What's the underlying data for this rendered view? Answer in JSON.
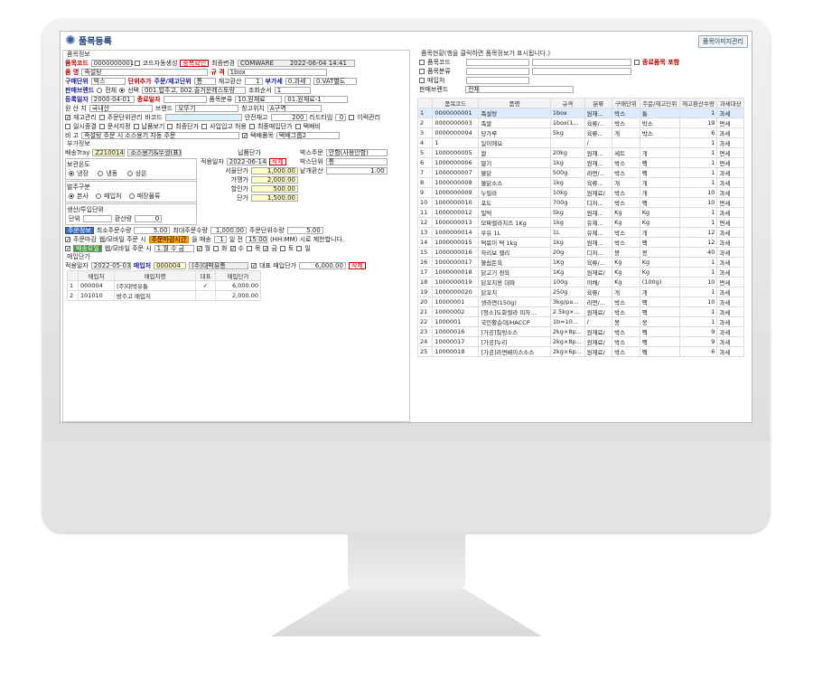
{
  "window": {
    "title": "품목등록",
    "image_button": "품목이미지관리"
  },
  "left": {
    "section_info": "품목정보",
    "code_label": "품목코드",
    "code_value": "0000000001",
    "auto_code": "코드자동생성",
    "dup_check": "중복확인",
    "last_changed_label": "최종변경",
    "last_changed_user": "COMWARE",
    "last_changed_time": "2022-06-04 14:41",
    "name_label": "품 명",
    "name_value": "족설탕",
    "spec_label": "규 격",
    "spec_value": "1box",
    "unit_label": "구매단위",
    "unit_value": "박스",
    "unit_add": "단위추가",
    "order_unit_label": "주문/재고단위",
    "order_unit_value": "통",
    "conv_label": "재고환산",
    "conv_value": "1",
    "tax_label": "부가세",
    "tax_value": "0.과세",
    "vat_value": "0.VAT별도",
    "brand_label": "판매브랜드",
    "brand_all": "전체",
    "brand_select": "선택",
    "brand_value": "001.밥주고, 002.즐거운레스토랑",
    "lookup_label": "조회순서",
    "lookup_value": "1",
    "reg_date_label": "등록일자",
    "reg_date_value": "2000-04-01",
    "end_date_label": "종료일자",
    "category_label": "품목분류",
    "category_value": "10.원재료",
    "category2_value": "01.원재료-1",
    "origin_label": "원 산 지",
    "origin_value": "국내산",
    "brandname_label": "브랜드",
    "brandname_value": "오뚜기",
    "warehouse_label": "창고위치",
    "warehouse_value": "A구역",
    "stock_mgmt": "재고관리",
    "order_unit_mgmt": "주문단위관리",
    "barcode_label": "바코드",
    "safety_label": "안전재고",
    "safety_value": "200",
    "leadtime_label": "리드타임",
    "leadtime_value": "0",
    "history_label": "이력관리",
    "daily_close": "일시종결",
    "no_print": "문서지정",
    "delivery": "납품보기",
    "final_price": "최종단가",
    "prepurchase": "사입입고 허용",
    "final_purchase": "최종매입단가",
    "tag": "택배비",
    "note_label": "비 고",
    "note_value": "즉설탕 주문 시 소스용기 자동 주문",
    "parcel_label": "택배품목",
    "parcel_value": "택배그룹2",
    "section_extra": "부가정보",
    "tray_label": "배송Tray",
    "tray_code": "Z210014",
    "tray_name": "소스용기&뚜껑(표)",
    "supply_section": "납품단가",
    "order_section": "박스주문",
    "order_value": "안함(사용안함)",
    "storage_section": "보관온도",
    "storage_opts": [
      "냉장",
      "냉동",
      "상온"
    ],
    "apply_date_label": "적용일자",
    "apply_date_value": "2022-06-14",
    "delete": "삭제",
    "box_unit_label": "박스단위",
    "box_unit_value": "통",
    "purchase_price_label": "서울단가",
    "purchase_price_value": "1,000.00",
    "piece_conv_label": "낱개환산",
    "piece_conv_value": "1.00",
    "order_type_section": "발주구분",
    "order_type_opts": [
      "본사",
      "매입처",
      "매장물류"
    ],
    "price1_label": "가맹가",
    "price1_value": "2,000.00",
    "prod_unit_section": "생산/투입단위",
    "disc_label": "할인가",
    "disc_value": "500.00",
    "unit2_label": "단위",
    "conv2_label": "환산량",
    "conv2_value": "0",
    "price2_label": "단가",
    "price2_value": "1,500.00",
    "order_info_btn": "주문정보",
    "min_order_label": "최소주문수량",
    "min_order_value": "5.00",
    "max_order_label": "최대주문수량",
    "max_order_value": "1,000.00",
    "order_step_label": "주문단위수량",
    "order_step_value": "5.00",
    "deadline_label": "주문마감",
    "deadline_text": "웹/모바일 주문 시",
    "deadline_btn": "주문마감시간",
    "deadline_text2": "을 매송",
    "deadline_days": "1",
    "deadline_days_label": "일 전",
    "deadline_time": "15:00",
    "deadline_note": "(HH:MM) 시로 제한합니다.",
    "delivery_day_btn": "배송요일",
    "delivery_day_text": "웹/모바일 주문 시",
    "delivery_day_value": "1.월 수 금",
    "days": [
      "월",
      "화",
      "수",
      "목",
      "금",
      "토",
      "일"
    ],
    "section_purchase": "매입단가",
    "p_apply_label": "적용일자",
    "p_apply_value": "2022-05-03",
    "p_vendor_label": "매입처",
    "p_vendor_code": "000004",
    "p_vendor_name": "(주)대박유통",
    "p_main_label": "대표 매입단가",
    "p_main_value": "6,000.00",
    "p_delete": "삭제",
    "p_cols": [
      "매입처",
      "매입처명",
      "대표",
      "매입단가"
    ],
    "p_rows": [
      [
        "1",
        "000004",
        "(주)대박유통",
        "✓",
        "6,000.00"
      ],
      [
        "2",
        "101010",
        "방주고 매입처",
        "",
        "2,000.00"
      ]
    ]
  },
  "right": {
    "header": "품목현황(행을 클릭하면 품목정보가 표시됩니다.)",
    "f_code": "품목코드",
    "f_end": "종료품목 포함",
    "f_category": "품목분류",
    "f_vendor": "매입처",
    "f_brand": "판매브랜드",
    "f_brand_value": "전체",
    "cols": [
      "품목코드",
      "품명",
      "규격",
      "분류",
      "구매단위",
      "주문/재고단위",
      "재고환산수량",
      "과세대상"
    ],
    "rows": [
      [
        "1",
        "0000000001",
        "족설탕",
        "1box",
        "원재...",
        "박스",
        "통",
        "1",
        "과세"
      ],
      [
        "2",
        "0000000003",
        "족쌀",
        "1box(1...",
        "육류/...",
        "박스",
        "박스",
        "19",
        "면세"
      ],
      [
        "3",
        "0000000004",
        "당가루",
        "5kg",
        "육류...",
        "개",
        "박스",
        "6",
        "과세"
      ],
      [
        "4",
        "1",
        "일이에요",
        "",
        "/",
        "",
        "",
        "1",
        "과세"
      ],
      [
        "5",
        "1000000005",
        "쌀",
        "20kg",
        "원재...",
        "세트",
        "개",
        "1",
        "면세"
      ],
      [
        "6",
        "1000000006",
        "딸기",
        "1kg",
        "원재...",
        "박스",
        "팩",
        "1",
        "면세"
      ],
      [
        "7",
        "1000000007",
        "불닭",
        "500g",
        "라면/...",
        "박스",
        "팩",
        "1",
        "과세"
      ],
      [
        "8",
        "1000000008",
        "불닭소스",
        "1kg",
        "육류...",
        "개",
        "개",
        "1",
        "과세"
      ],
      [
        "9",
        "1000000009",
        "누릴라",
        "10kg",
        "원재료/",
        "박스",
        "개",
        "10",
        "과세"
      ],
      [
        "10",
        "1000000010",
        "포도",
        "700g",
        "디저...",
        "박스",
        "팩",
        "10",
        "면세"
      ],
      [
        "11",
        "1000000012",
        "밀떡",
        "5kg",
        "원재...",
        "Kg",
        "Kg",
        "1",
        "과세"
      ],
      [
        "12",
        "1000000013",
        "모짜렐라치즈 1Kg",
        "1kg",
        "유제...",
        "Kg",
        "Kg",
        "1",
        "면세"
      ],
      [
        "13",
        "1000000014",
        "우유 1L",
        "1L",
        "유제...",
        "박스",
        "개",
        "12",
        "과세"
      ],
      [
        "14",
        "1000000015",
        "떡볶이 떡 1kg",
        "1kg",
        "원재...",
        "박스",
        "팩",
        "12",
        "과세"
      ],
      [
        "15",
        "1000000016",
        "하리보 젤리",
        "20g",
        "디저...",
        "봉",
        "봉",
        "40",
        "과세"
      ],
      [
        "16",
        "1000000017",
        "불쉽돈육",
        "1Kg",
        "육류/...",
        "Kg",
        "Kg",
        "1",
        "과세"
      ],
      [
        "17",
        "1000000018",
        "닭고기 정육",
        "1Kg",
        "원재료/",
        "Kg",
        "Kg",
        "1",
        "과세"
      ],
      [
        "18",
        "1000000019",
        "닭꼬치용 대파",
        "100g",
        "야채/",
        "Kg",
        "(100g)",
        "10",
        "면세"
      ],
      [
        "19",
        "1000000020",
        "닭꼬치",
        "250g",
        "육류/",
        "개",
        "개",
        "1",
        "과세"
      ],
      [
        "20",
        "10000001",
        "생라면(150g)",
        "3kg/pa...",
        "라면/...",
        "박스",
        "팩",
        "10",
        "과세"
      ],
      [
        "21",
        "10000002",
        "[청소]도화렐라 피자...",
        "2.5kg×...",
        "원재료/",
        "박스",
        "팩",
        "1",
        "과세"
      ],
      [
        "22",
        "1000001",
        "국민활순대/HACCP",
        "1b=10...",
        "/",
        "봉",
        "봉",
        "1",
        "과세"
      ],
      [
        "23",
        "10000016",
        "[가공]칠링소스",
        "2kg×8p...",
        "원재료/",
        "박스",
        "팩",
        "9",
        "과세"
      ],
      [
        "24",
        "10000017",
        "[가공]누리",
        "2kg×8p...",
        "원재료/",
        "박스",
        "팩",
        "9",
        "과세"
      ],
      [
        "25",
        "10000018",
        "[가공]라면베이스소스",
        "2kg×6p...",
        "원재료/",
        "박스",
        "팩",
        "6",
        "과세"
      ]
    ]
  }
}
